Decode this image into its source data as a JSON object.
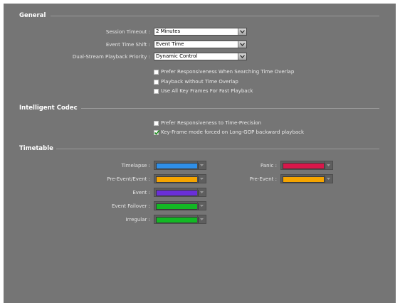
{
  "general": {
    "title": "General",
    "session_timeout": {
      "label": "Session Timeout :",
      "value": "2 Minutes"
    },
    "event_time_shift": {
      "label": "Event Time Shift :",
      "value": "Event Time"
    },
    "dual_stream": {
      "label": "Dual-Stream Playback Priority :",
      "value": "Dynamic Control"
    },
    "checks": [
      {
        "label": "Prefer Responsiveness When Searching Time Overlap",
        "checked": false
      },
      {
        "label": "Playback without Time Overlap",
        "checked": false
      },
      {
        "label": "Use All Key Frames For Fast Playback",
        "checked": false
      }
    ]
  },
  "intelligent_codec": {
    "title": "Intelligent Codec",
    "checks": [
      {
        "label": "Prefer Responsiveness to Time-Precision",
        "checked": false
      },
      {
        "label": "Key-Frame mode forced on Long-GOP backward playback",
        "checked": true
      }
    ]
  },
  "timetable": {
    "title": "Timetable",
    "left": [
      {
        "label": "Timelapse :",
        "color": "#2f8fe8"
      },
      {
        "label": "Pre-Event/Event :",
        "color": "#f5a400"
      },
      {
        "label": "Event :",
        "color": "#6a2fd8"
      },
      {
        "label": "Event Failover :",
        "color": "#12b824"
      },
      {
        "label": "Irregular :",
        "color": "#12b824"
      }
    ],
    "right": [
      {
        "label": "Panic :",
        "color": "#d8174a"
      },
      {
        "label": "Pre-Event :",
        "color": "#f5a400"
      }
    ]
  },
  "icons": {
    "dropdown": "chevron-down-icon",
    "check": "checkmark-icon"
  }
}
